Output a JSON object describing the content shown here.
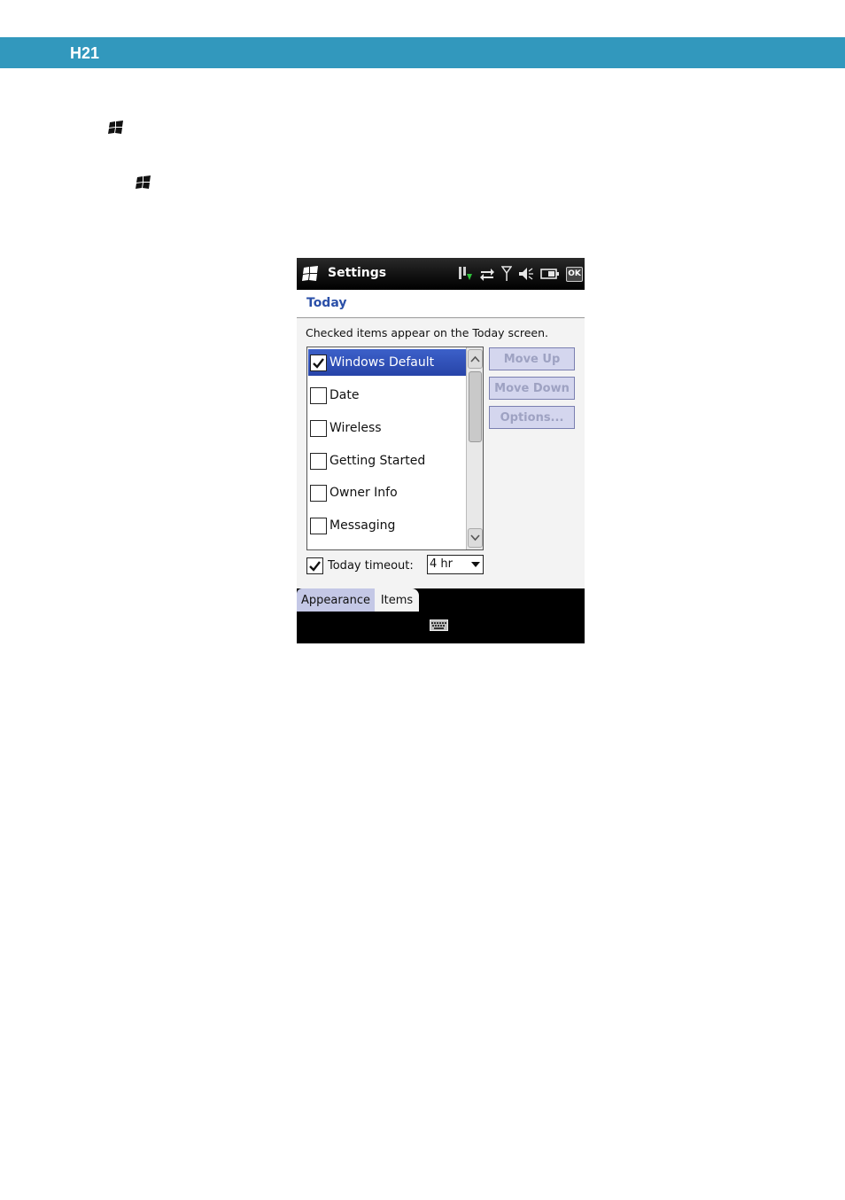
{
  "document": {
    "header_label": "H21",
    "header_color": "#3298bd"
  },
  "icons": {
    "doc_flag_1": "windows-flag-icon",
    "doc_flag_2": "windows-flag-icon",
    "start": "windows-start-icon",
    "status": [
      "data-transfer-icon",
      "connectivity-arrows-icon",
      "signal-antenna-icon",
      "speaker-muted-icon",
      "battery-icon"
    ],
    "keyboard": "keyboard-icon"
  },
  "device": {
    "app_title": "Settings",
    "ok_label": "OK",
    "page_heading": "Today",
    "instruction": "Checked items appear on the Today screen.",
    "items": [
      {
        "label": "Windows Default",
        "checked": true,
        "selected": true
      },
      {
        "label": "Date",
        "checked": false,
        "selected": false
      },
      {
        "label": "Wireless",
        "checked": false,
        "selected": false
      },
      {
        "label": "Getting Started",
        "checked": false,
        "selected": false
      },
      {
        "label": "Owner Info",
        "checked": false,
        "selected": false
      },
      {
        "label": "Messaging",
        "checked": false,
        "selected": false
      }
    ],
    "buttons": {
      "move_up": "Move Up",
      "move_down": "Move Down",
      "options": "Options..."
    },
    "timeout": {
      "label": "Today timeout:",
      "checked": true,
      "value": "4 hr"
    },
    "tabs": {
      "appearance": "Appearance",
      "items": "Items",
      "active": "Items"
    },
    "colors": {
      "selection": "#2f4fb5",
      "heading": "#2a4fa8",
      "disabled_button": "#d4d6ee"
    }
  }
}
